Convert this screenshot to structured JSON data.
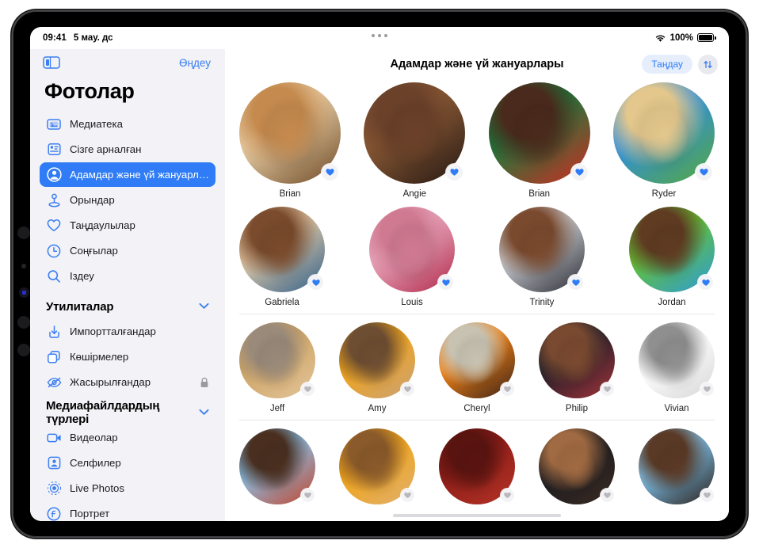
{
  "status_bar": {
    "time": "09:41",
    "date": "5 мау. дс",
    "battery_percent": "100%",
    "wifi_icon": "wifi-icon",
    "battery_icon": "battery-icon",
    "multitask_dots_icon": "multitask-dots-icon"
  },
  "sidebar": {
    "toggle_icon": "sidebar-toggle-icon",
    "edit_label": "Өңдеу",
    "title": "Фотолар",
    "items": [
      {
        "label": "Медиатека",
        "icon": "photo-library-icon",
        "selected": false
      },
      {
        "label": "Сізге арналған",
        "icon": "for-you-icon",
        "selected": false
      },
      {
        "label": "Адамдар және үй жануарлары",
        "icon": "people-pets-icon",
        "selected": true
      },
      {
        "label": "Орындар",
        "icon": "places-pin-icon",
        "selected": false
      },
      {
        "label": "Таңдаулылар",
        "icon": "heart-icon",
        "selected": false
      },
      {
        "label": "Соңғылар",
        "icon": "clock-icon",
        "selected": false
      },
      {
        "label": "Іздеу",
        "icon": "search-icon",
        "selected": false
      }
    ],
    "sections": [
      {
        "title": "Утилиталар",
        "chevron_icon": "chevron-down-icon",
        "items": [
          {
            "label": "Импортталғандар",
            "icon": "import-icon",
            "trailing_icon": ""
          },
          {
            "label": "Көшірмелер",
            "icon": "duplicates-icon",
            "trailing_icon": ""
          },
          {
            "label": "Жасырылғандар",
            "icon": "hidden-eye-icon",
            "trailing_icon": "lock-icon"
          }
        ]
      },
      {
        "title": "Медиафайлдардың түрлері",
        "chevron_icon": "chevron-down-icon",
        "items": [
          {
            "label": "Видеолар",
            "icon": "video-icon",
            "trailing_icon": ""
          },
          {
            "label": "Селфилер",
            "icon": "selfie-icon",
            "trailing_icon": ""
          },
          {
            "label": "Live Photos",
            "icon": "live-photos-icon",
            "trailing_icon": ""
          },
          {
            "label": "Портрет",
            "icon": "portrait-icon",
            "trailing_icon": ""
          }
        ]
      }
    ]
  },
  "main": {
    "title": "Адамдар және үй жануарлары",
    "select_label": "Таңдау",
    "sort_icon": "sort-arrows-icon",
    "rows": [
      {
        "size": "size-lg",
        "separator": false,
        "people": [
          {
            "name": "Brian",
            "favorite": true,
            "c1": "#e8cfa8",
            "c2": "#6e4a26",
            "c3": "#c58a4e"
          },
          {
            "name": "Angie",
            "favorite": true,
            "c1": "#8a5a34",
            "c2": "#241713",
            "c3": "#6b412a"
          },
          {
            "name": "Brian",
            "favorite": true,
            "c1": "#1a7a3c",
            "c2": "#d12b22",
            "c3": "#4a2a1c"
          },
          {
            "name": "Ryder",
            "favorite": true,
            "c1": "#2f8ede",
            "c2": "#57a83c",
            "c3": "#e3c78c"
          }
        ]
      },
      {
        "size": "size-md",
        "separator": false,
        "people": [
          {
            "name": "Gabriela",
            "favorite": true,
            "c1": "#e2c9a6",
            "c2": "#2f5f8a",
            "c3": "#7a4b2c"
          },
          {
            "name": "Louis",
            "favorite": true,
            "c1": "#e8a8bd",
            "c2": "#b1294b",
            "c3": "#d07a92"
          },
          {
            "name": "Trinity",
            "favorite": true,
            "c1": "#c9cdd2",
            "c2": "#2b2b33",
            "c3": "#7a4a2e"
          },
          {
            "name": "Jordan",
            "favorite": true,
            "c1": "#63c232",
            "c2": "#2f9bd8",
            "c3": "#5f3b22"
          }
        ]
      },
      {
        "size": "size-sm",
        "separator": true,
        "people": [
          {
            "name": "Jeff",
            "favorite": false,
            "c1": "#cda463",
            "c2": "#e3c49b",
            "c3": "#9a8a7a"
          },
          {
            "name": "Amy",
            "favorite": false,
            "c1": "#f0a417",
            "c2": "#caa27a",
            "c3": "#6e4e32"
          },
          {
            "name": "Cheryl",
            "favorite": false,
            "c1": "#f08216",
            "c2": "#3a2218",
            "c3": "#c8c2b2"
          },
          {
            "name": "Philip",
            "favorite": false,
            "c1": "#1d1d28",
            "c2": "#a4343a",
            "c3": "#7a4a30"
          },
          {
            "name": "Vivian",
            "favorite": false,
            "c1": "#ffffff",
            "c2": "#d7d7d7",
            "c3": "#8f8f8f"
          }
        ]
      },
      {
        "size": "size-sm",
        "separator": true,
        "people": [
          {
            "name": "",
            "favorite": false,
            "c1": "#88c0e8",
            "c2": "#c3452a",
            "c3": "#4a2f20"
          },
          {
            "name": "",
            "favorite": false,
            "c1": "#f0a417",
            "c2": "#e0b070",
            "c3": "#8a5a2a"
          },
          {
            "name": "",
            "favorite": false,
            "c1": "#8e1d18",
            "c2": "#b33226",
            "c3": "#5a1410"
          },
          {
            "name": "",
            "favorite": false,
            "c1": "#1b1b1f",
            "c2": "#3a2a22",
            "c3": "#a06a42"
          },
          {
            "name": "",
            "favorite": false,
            "c1": "#7ec3ec",
            "c2": "#2a1e18",
            "c3": "#5a3a26"
          }
        ]
      }
    ]
  },
  "colors": {
    "accent_blue": "#2f7cf6",
    "sidebar_bg": "#f2f2f7",
    "favorite_blue": "#2f7cf6",
    "badge_gray": "#b8b8bd"
  }
}
